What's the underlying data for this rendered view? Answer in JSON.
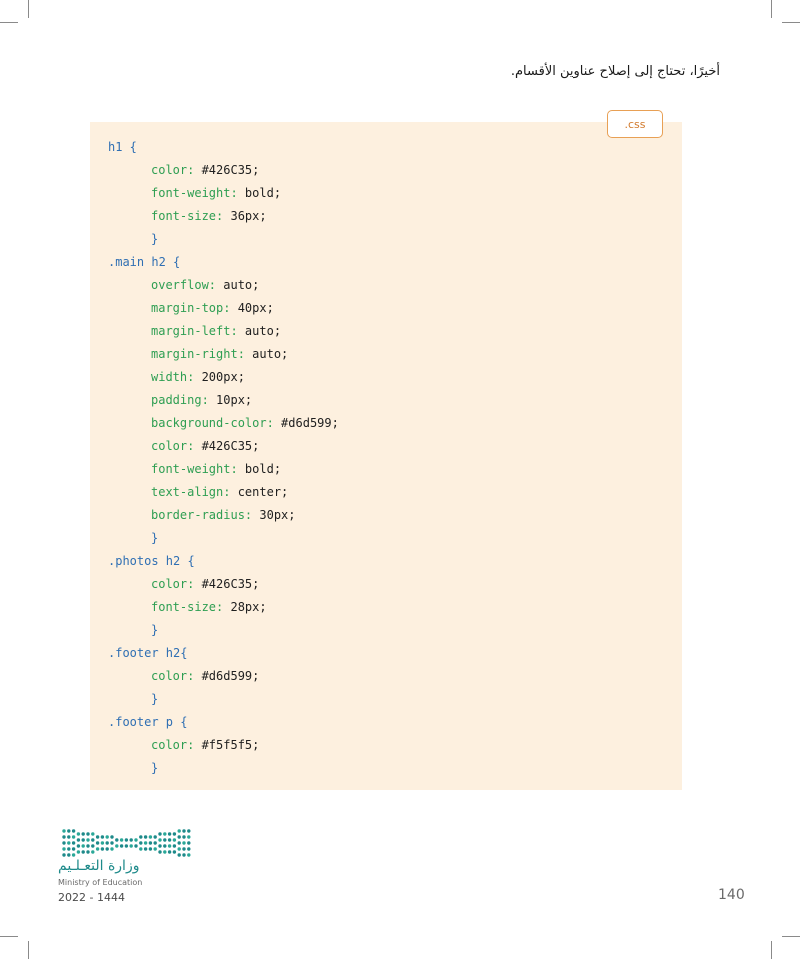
{
  "intro_text": "أخيرًا، تحتاج إلى إصلاح عناوين الأقسام.",
  "file_tab": ".css",
  "code_lines": [
    [
      {
        "t": "sel",
        "s": "h1 {"
      }
    ],
    [
      {
        "t": "prop",
        "s": "color:"
      },
      {
        "t": "val",
        "s": " #426C35;"
      }
    ],
    [
      {
        "t": "prop",
        "s": "font-weight:"
      },
      {
        "t": "val",
        "s": " bold;"
      }
    ],
    [
      {
        "t": "prop",
        "s": "font-size:"
      },
      {
        "t": "val",
        "s": " 36px;"
      }
    ],
    [
      {
        "t": "brace",
        "s": "}"
      }
    ],
    [
      {
        "t": "sel",
        "s": ".main h2 {"
      }
    ],
    [
      {
        "t": "prop",
        "s": "overflow:"
      },
      {
        "t": "val",
        "s": " auto;"
      }
    ],
    [
      {
        "t": "prop",
        "s": "margin-top:"
      },
      {
        "t": "val",
        "s": " 40px;"
      }
    ],
    [
      {
        "t": "prop",
        "s": "margin-left:"
      },
      {
        "t": "val",
        "s": " auto;"
      }
    ],
    [
      {
        "t": "prop",
        "s": "margin-right:"
      },
      {
        "t": "val",
        "s": " auto;"
      }
    ],
    [
      {
        "t": "prop",
        "s": "width:"
      },
      {
        "t": "val",
        "s": " 200px;"
      }
    ],
    [
      {
        "t": "prop",
        "s": "padding:"
      },
      {
        "t": "val",
        "s": " 10px;"
      }
    ],
    [
      {
        "t": "prop",
        "s": "background-color:"
      },
      {
        "t": "val",
        "s": " #d6d599;"
      }
    ],
    [
      {
        "t": "prop",
        "s": "color:"
      },
      {
        "t": "val",
        "s": " #426C35;"
      }
    ],
    [
      {
        "t": "prop",
        "s": "font-weight:"
      },
      {
        "t": "val",
        "s": " bold;"
      }
    ],
    [
      {
        "t": "prop",
        "s": "text-align:"
      },
      {
        "t": "val",
        "s": " center;"
      }
    ],
    [
      {
        "t": "prop",
        "s": "border-radius:"
      },
      {
        "t": "val",
        "s": " 30px;"
      }
    ],
    [
      {
        "t": "brace",
        "s": "}"
      }
    ],
    [
      {
        "t": "sel",
        "s": ".photos h2 {"
      }
    ],
    [
      {
        "t": "prop",
        "s": "color:"
      },
      {
        "t": "val",
        "s": " #426C35;"
      }
    ],
    [
      {
        "t": "prop",
        "s": "font-size:"
      },
      {
        "t": "val",
        "s": " 28px;"
      }
    ],
    [
      {
        "t": "brace",
        "s": "}"
      }
    ],
    [
      {
        "t": "sel",
        "s": ".footer h2{"
      }
    ],
    [
      {
        "t": "prop",
        "s": "color:"
      },
      {
        "t": "val",
        "s": " #d6d599;"
      }
    ],
    [
      {
        "t": "brace",
        "s": "}"
      }
    ],
    [
      {
        "t": "sel",
        "s": ".footer p {"
      }
    ],
    [
      {
        "t": "prop",
        "s": "color:"
      },
      {
        "t": "val",
        "s": " #f5f5f5;"
      }
    ],
    [
      {
        "t": "brace",
        "s": "}"
      }
    ]
  ],
  "footer": {
    "ministry_ar": "وزارة التعـلـيم",
    "ministry_en": "Ministry of Education",
    "year": "2022 - 1444",
    "page_number": "140"
  },
  "colors": {
    "code_background": "#fdf0df",
    "tab_border": "#e8a055",
    "selector": "#2f6fb3",
    "property": "#2e9e52",
    "value": "#1f1f1f",
    "logo_teal": "#1e8a8a"
  },
  "icons": [
    "ministry-of-education-logo"
  ]
}
